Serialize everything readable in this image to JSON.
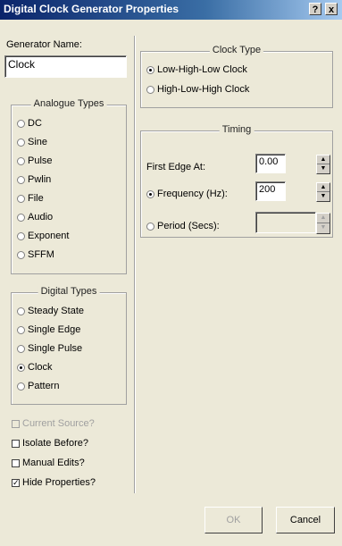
{
  "window": {
    "title": "Digital Clock Generator Properties",
    "help_label": "?",
    "close_label": "x"
  },
  "generator_name": {
    "label": "Generator Name:",
    "value": "Clock"
  },
  "analogue_types": {
    "title": "Analogue Types",
    "options": [
      "DC",
      "Sine",
      "Pulse",
      "Pwlin",
      "File",
      "Audio",
      "Exponent",
      "SFFM"
    ]
  },
  "digital_types": {
    "title": "Digital Types",
    "options": [
      "Steady State",
      "Single Edge",
      "Single Pulse",
      "Clock",
      "Pattern"
    ],
    "selected": "Clock"
  },
  "checkboxes": {
    "current_source": {
      "label": "Current Source?",
      "checked": false,
      "enabled": false
    },
    "isolate_before": {
      "label": "Isolate Before?",
      "checked": false,
      "enabled": true
    },
    "manual_edits": {
      "label": "Manual Edits?",
      "checked": false,
      "enabled": true
    },
    "hide_properties": {
      "label": "Hide Properties?",
      "checked": true,
      "enabled": true
    }
  },
  "clock_type": {
    "title": "Clock Type",
    "options": [
      "Low-High-Low Clock",
      "High-Low-High Clock"
    ],
    "selected": "Low-High-Low Clock"
  },
  "timing": {
    "title": "Timing",
    "first_edge": {
      "label": "First Edge At:",
      "value": "0.00"
    },
    "frequency": {
      "label": "Frequency (Hz):",
      "value": "200",
      "selected": true
    },
    "period": {
      "label": "Period (Secs):",
      "value": "",
      "selected": false
    }
  },
  "buttons": {
    "ok": "OK",
    "cancel": "Cancel"
  }
}
